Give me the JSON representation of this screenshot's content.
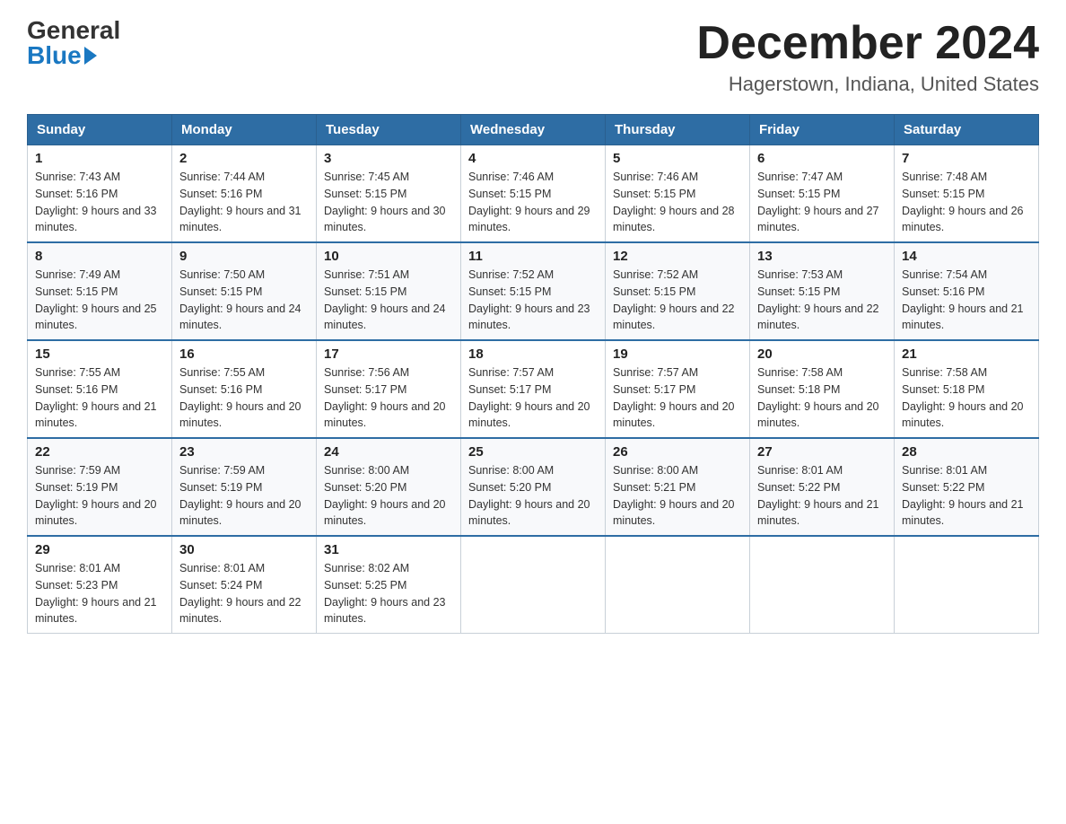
{
  "logo": {
    "general": "General",
    "blue": "Blue"
  },
  "title": "December 2024",
  "subtitle": "Hagerstown, Indiana, United States",
  "days_of_week": [
    "Sunday",
    "Monday",
    "Tuesday",
    "Wednesday",
    "Thursday",
    "Friday",
    "Saturday"
  ],
  "weeks": [
    [
      {
        "day": "1",
        "sunrise": "7:43 AM",
        "sunset": "5:16 PM",
        "daylight": "9 hours and 33 minutes."
      },
      {
        "day": "2",
        "sunrise": "7:44 AM",
        "sunset": "5:16 PM",
        "daylight": "9 hours and 31 minutes."
      },
      {
        "day": "3",
        "sunrise": "7:45 AM",
        "sunset": "5:15 PM",
        "daylight": "9 hours and 30 minutes."
      },
      {
        "day": "4",
        "sunrise": "7:46 AM",
        "sunset": "5:15 PM",
        "daylight": "9 hours and 29 minutes."
      },
      {
        "day": "5",
        "sunrise": "7:46 AM",
        "sunset": "5:15 PM",
        "daylight": "9 hours and 28 minutes."
      },
      {
        "day": "6",
        "sunrise": "7:47 AM",
        "sunset": "5:15 PM",
        "daylight": "9 hours and 27 minutes."
      },
      {
        "day": "7",
        "sunrise": "7:48 AM",
        "sunset": "5:15 PM",
        "daylight": "9 hours and 26 minutes."
      }
    ],
    [
      {
        "day": "8",
        "sunrise": "7:49 AM",
        "sunset": "5:15 PM",
        "daylight": "9 hours and 25 minutes."
      },
      {
        "day": "9",
        "sunrise": "7:50 AM",
        "sunset": "5:15 PM",
        "daylight": "9 hours and 24 minutes."
      },
      {
        "day": "10",
        "sunrise": "7:51 AM",
        "sunset": "5:15 PM",
        "daylight": "9 hours and 24 minutes."
      },
      {
        "day": "11",
        "sunrise": "7:52 AM",
        "sunset": "5:15 PM",
        "daylight": "9 hours and 23 minutes."
      },
      {
        "day": "12",
        "sunrise": "7:52 AM",
        "sunset": "5:15 PM",
        "daylight": "9 hours and 22 minutes."
      },
      {
        "day": "13",
        "sunrise": "7:53 AM",
        "sunset": "5:15 PM",
        "daylight": "9 hours and 22 minutes."
      },
      {
        "day": "14",
        "sunrise": "7:54 AM",
        "sunset": "5:16 PM",
        "daylight": "9 hours and 21 minutes."
      }
    ],
    [
      {
        "day": "15",
        "sunrise": "7:55 AM",
        "sunset": "5:16 PM",
        "daylight": "9 hours and 21 minutes."
      },
      {
        "day": "16",
        "sunrise": "7:55 AM",
        "sunset": "5:16 PM",
        "daylight": "9 hours and 20 minutes."
      },
      {
        "day": "17",
        "sunrise": "7:56 AM",
        "sunset": "5:17 PM",
        "daylight": "9 hours and 20 minutes."
      },
      {
        "day": "18",
        "sunrise": "7:57 AM",
        "sunset": "5:17 PM",
        "daylight": "9 hours and 20 minutes."
      },
      {
        "day": "19",
        "sunrise": "7:57 AM",
        "sunset": "5:17 PM",
        "daylight": "9 hours and 20 minutes."
      },
      {
        "day": "20",
        "sunrise": "7:58 AM",
        "sunset": "5:18 PM",
        "daylight": "9 hours and 20 minutes."
      },
      {
        "day": "21",
        "sunrise": "7:58 AM",
        "sunset": "5:18 PM",
        "daylight": "9 hours and 20 minutes."
      }
    ],
    [
      {
        "day": "22",
        "sunrise": "7:59 AM",
        "sunset": "5:19 PM",
        "daylight": "9 hours and 20 minutes."
      },
      {
        "day": "23",
        "sunrise": "7:59 AM",
        "sunset": "5:19 PM",
        "daylight": "9 hours and 20 minutes."
      },
      {
        "day": "24",
        "sunrise": "8:00 AM",
        "sunset": "5:20 PM",
        "daylight": "9 hours and 20 minutes."
      },
      {
        "day": "25",
        "sunrise": "8:00 AM",
        "sunset": "5:20 PM",
        "daylight": "9 hours and 20 minutes."
      },
      {
        "day": "26",
        "sunrise": "8:00 AM",
        "sunset": "5:21 PM",
        "daylight": "9 hours and 20 minutes."
      },
      {
        "day": "27",
        "sunrise": "8:01 AM",
        "sunset": "5:22 PM",
        "daylight": "9 hours and 21 minutes."
      },
      {
        "day": "28",
        "sunrise": "8:01 AM",
        "sunset": "5:22 PM",
        "daylight": "9 hours and 21 minutes."
      }
    ],
    [
      {
        "day": "29",
        "sunrise": "8:01 AM",
        "sunset": "5:23 PM",
        "daylight": "9 hours and 21 minutes."
      },
      {
        "day": "30",
        "sunrise": "8:01 AM",
        "sunset": "5:24 PM",
        "daylight": "9 hours and 22 minutes."
      },
      {
        "day": "31",
        "sunrise": "8:02 AM",
        "sunset": "5:25 PM",
        "daylight": "9 hours and 23 minutes."
      },
      null,
      null,
      null,
      null
    ]
  ]
}
